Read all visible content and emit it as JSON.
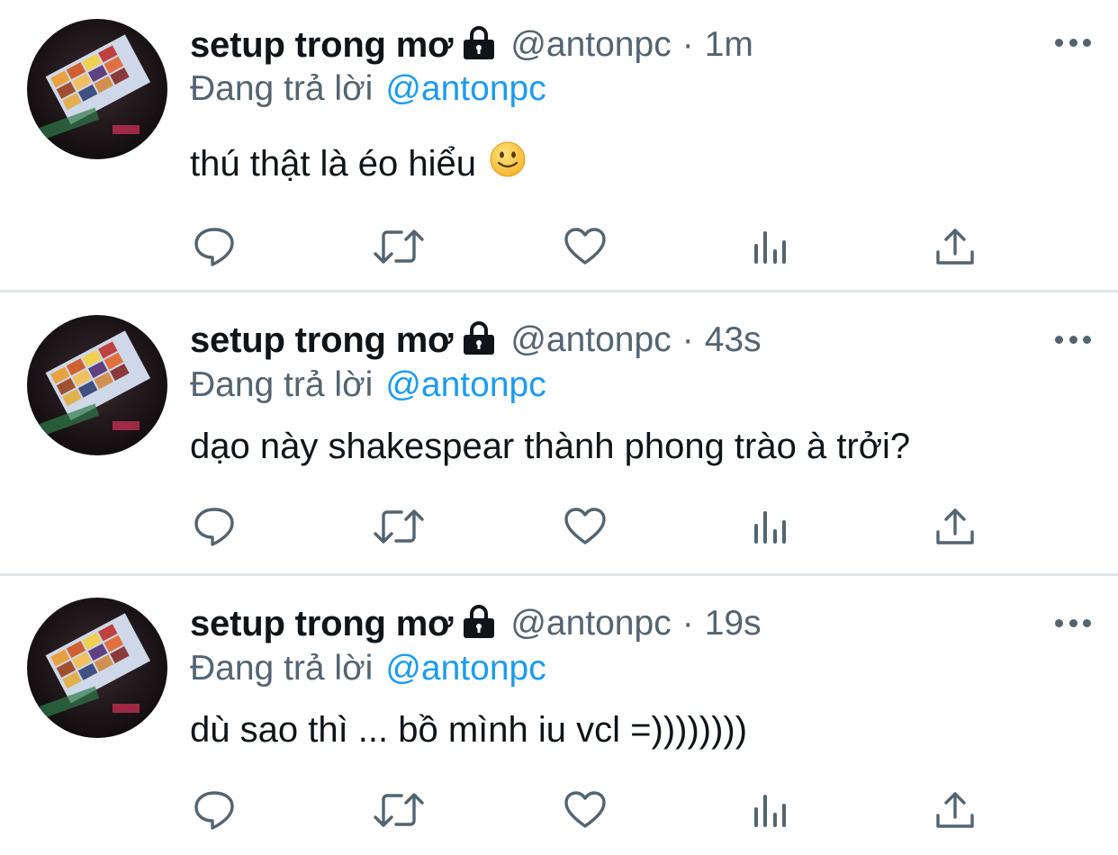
{
  "tweets": [
    {
      "author_name": "setup trong mơ",
      "handle": "@antonpc",
      "separator": "·",
      "time": "1m",
      "reply_prefix": "Đang trả lời",
      "reply_to": "@antonpc",
      "text": "thú thật là éo hiểu",
      "emoji": "slightly-smiling-face"
    },
    {
      "author_name": "setup trong mơ",
      "handle": "@antonpc",
      "separator": "·",
      "time": "43s",
      "reply_prefix": "Đang trả lời",
      "reply_to": "@antonpc",
      "text": "dạo này shakespear thành phong trào à trởi?"
    },
    {
      "author_name": "setup trong mơ",
      "handle": "@antonpc",
      "separator": "·",
      "time": "19s",
      "reply_prefix": "Đang trả lời",
      "reply_to": "@antonpc",
      "text": "dù sao thì ... bồ mình iu vcl =))))))))"
    }
  ],
  "icons": {
    "lock": "lock-icon",
    "more": "more-options-icon",
    "reply": "reply-icon",
    "retweet": "retweet-icon",
    "like": "heart-icon",
    "views": "views-icon",
    "share": "share-icon"
  },
  "colors": {
    "text": "#0f1419",
    "secondary": "#536471",
    "mention": "#1d9bf0",
    "divider": "#e1e6ea"
  }
}
